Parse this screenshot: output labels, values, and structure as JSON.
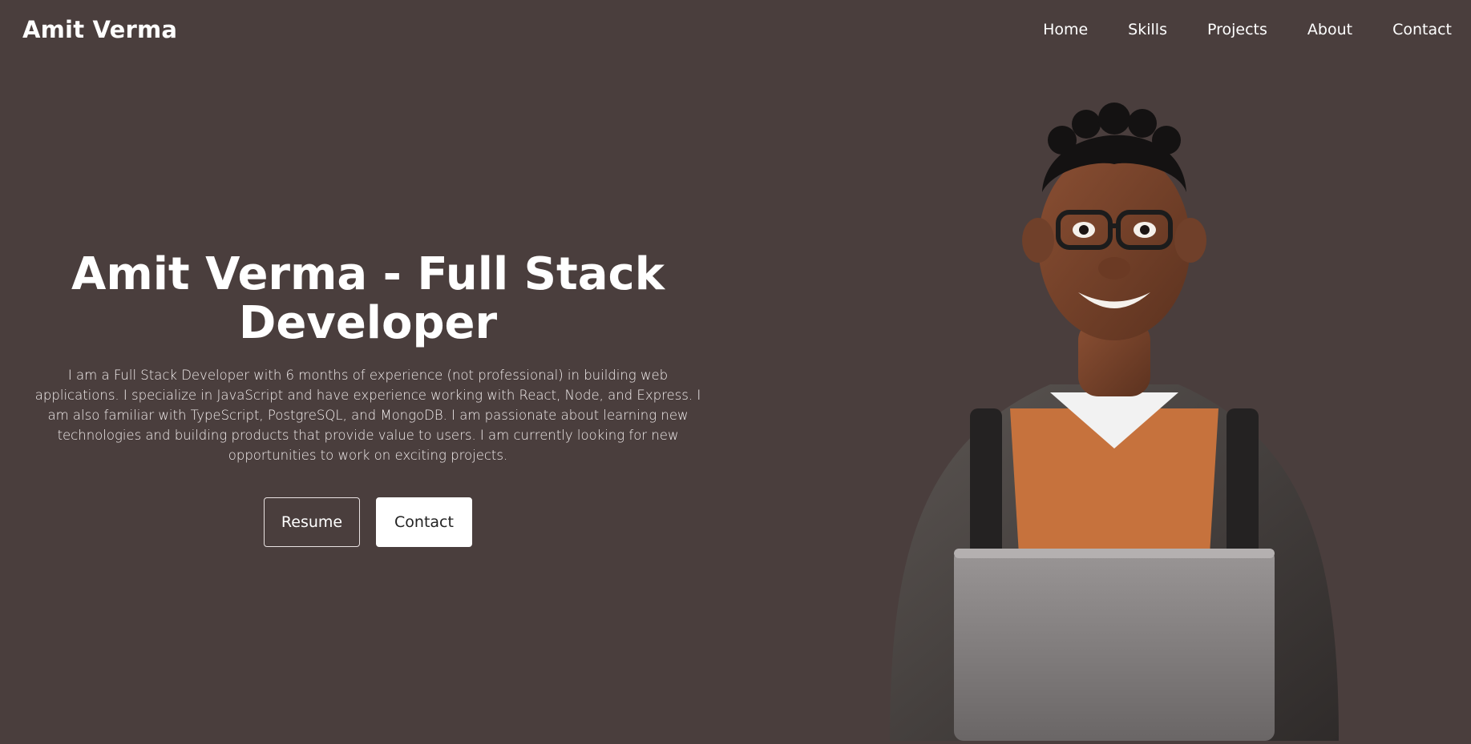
{
  "nav": {
    "brand": "Amit Verma",
    "links": [
      "Home",
      "Skills",
      "Projects",
      "About",
      "Contact"
    ]
  },
  "hero": {
    "title": "Amit Verma - Full Stack Developer",
    "description": "I am a Full Stack Developer with 6 months of experience (not professional) in building web applications. I specialize in JavaScript and have experience working with React, Node, and Express. I am also familiar with TypeScript, PostgreSQL, and MongoDB. I am passionate about learning new technologies and building products that provide value to users. I am currently looking for new opportunities to work on exciting projects.",
    "buttons": {
      "resume": "Resume",
      "contact": "Contact"
    },
    "image_icon": "developer-avatar-illustration"
  },
  "colors": {
    "background": "#4a3e3d",
    "text": "#ffffff",
    "button_solid_bg": "#ffffff",
    "button_solid_text": "#222222"
  }
}
